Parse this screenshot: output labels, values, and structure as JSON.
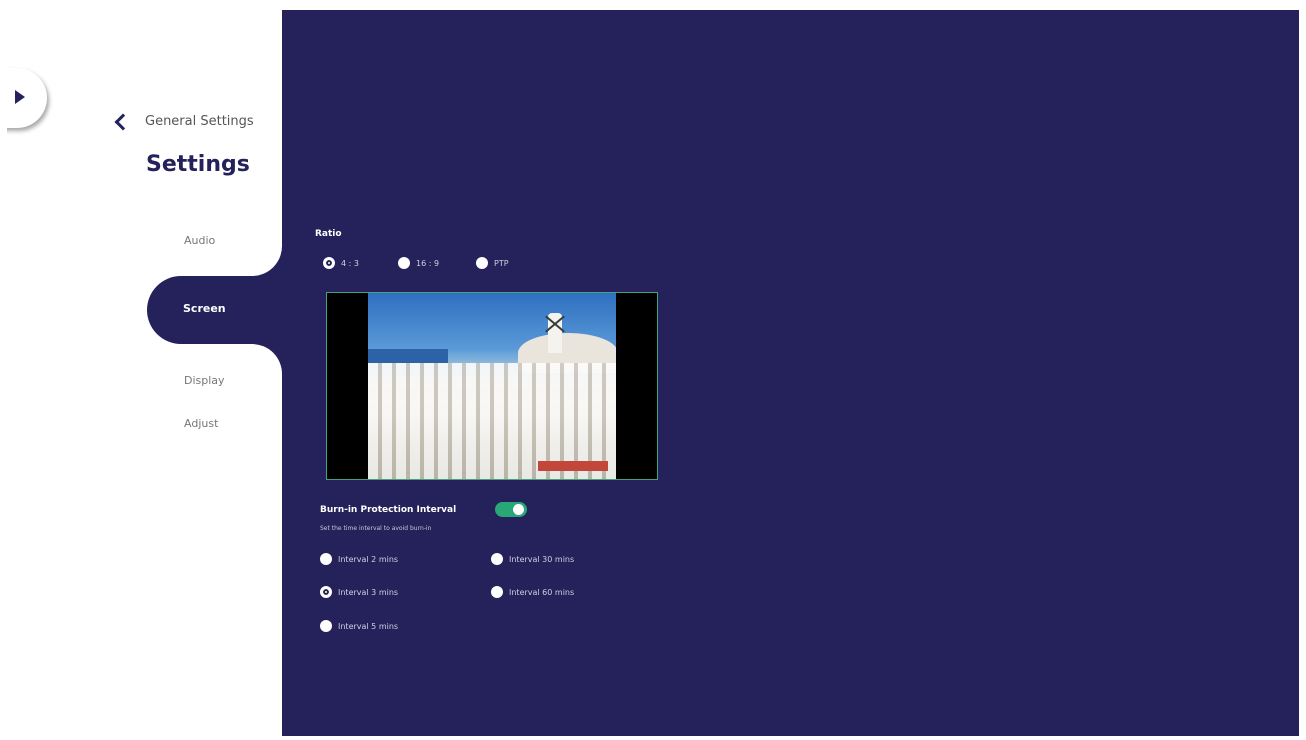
{
  "sidebar": {
    "back_label": "General Settings",
    "title": "Settings",
    "items": [
      {
        "label": "Audio",
        "active": false
      },
      {
        "label": "Screen",
        "active": true
      },
      {
        "label": "Display",
        "active": false
      },
      {
        "label": "Adjust",
        "active": false
      }
    ]
  },
  "ratio": {
    "label": "Ratio",
    "options": [
      {
        "label": "4 : 3",
        "selected": true
      },
      {
        "label": "16 : 9",
        "selected": false
      },
      {
        "label": "PTP",
        "selected": false
      }
    ]
  },
  "preview": {
    "icon": "photo-preview-icon"
  },
  "burn_in": {
    "label": "Burn-in Protection Interval",
    "toggle_on": true,
    "description": "Set the time interval to avoid burn-in",
    "options": [
      {
        "label": "Interval 2 mins",
        "selected": false
      },
      {
        "label": "Interval 30 mins",
        "selected": false
      },
      {
        "label": "Interval 3 mins",
        "selected": true
      },
      {
        "label": "Interval 60 mins",
        "selected": false
      },
      {
        "label": "Interval 5 mins",
        "selected": false
      }
    ]
  },
  "colors": {
    "navy": "#24215b",
    "toggle_green": "#28a877",
    "preview_border": "#3fa57a"
  }
}
